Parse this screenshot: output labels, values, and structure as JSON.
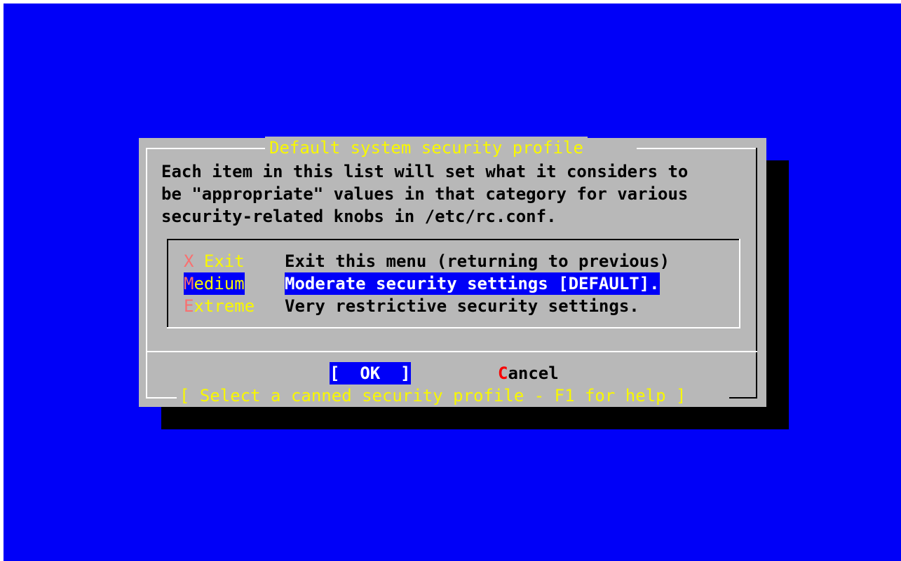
{
  "dialog": {
    "title": "Default system security profile",
    "description": [
      "Each item in this list will set what it considers to",
      "be \"appropriate\" values in that category for various",
      "security-related knobs in /etc/rc.conf."
    ],
    "menu": [
      {
        "key": "X Exit",
        "label": "Exit this menu (returning to previous)",
        "selected": false
      },
      {
        "key": "Medium",
        "label": "Moderate security settings [DEFAULT].",
        "selected": true
      },
      {
        "key": "Extreme",
        "label": "Very restrictive security settings.",
        "selected": false
      }
    ],
    "buttons": {
      "ok": "[  OK  ]",
      "cancel": "Cancel"
    },
    "footer": "[ Select a canned security profile - F1 for help ]"
  },
  "colors": {
    "background": "#0000f8",
    "dialog": "#b8b8b8",
    "title": "#f8f800",
    "hotkey": "#f87070",
    "selection": "#0000f8"
  }
}
